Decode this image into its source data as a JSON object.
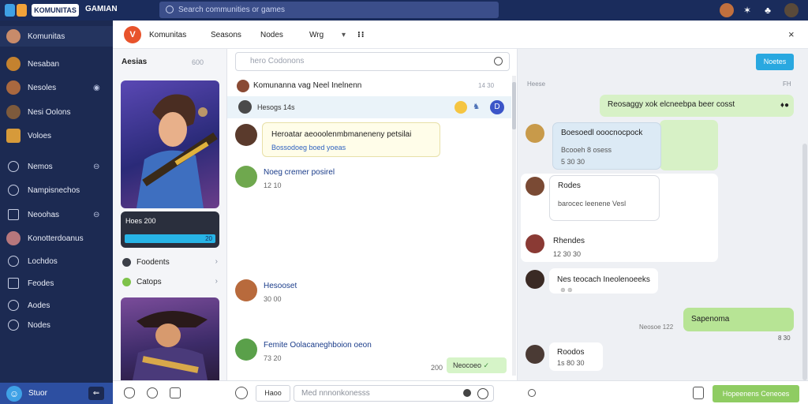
{
  "topbar": {
    "brand_pill": "KOMUNITAS",
    "brand": "GAMIAN",
    "search_placeholder": "Search communities or games",
    "colors": {
      "bg": "#1a2c5c",
      "search": "#3b4e8a"
    }
  },
  "sidebar": {
    "items": [
      {
        "label": "Komunitas"
      },
      {
        "label": "Nesaban"
      },
      {
        "label": "Nesoles"
      },
      {
        "label": "Nesi Oolons"
      },
      {
        "label": "Voloes"
      },
      {
        "label": "Nemos"
      },
      {
        "label": "Nampisnechos"
      },
      {
        "label": "Neoohas"
      },
      {
        "label": "Konotterdoanus"
      },
      {
        "label": "Lochdos"
      },
      {
        "label": "Feodes"
      },
      {
        "label": "Aodes"
      },
      {
        "label": "Nodes"
      }
    ],
    "footer": {
      "label": "Stuor",
      "button": "⇐"
    }
  },
  "header": {
    "tabs": [
      "Komunitas",
      "Seasons",
      "Nodes",
      "Wrg"
    ],
    "close": "×"
  },
  "games": {
    "title": "Aesias",
    "title_right": "600",
    "card1_footer": "Hoes 200",
    "card1_bar_value": "20",
    "rows": [
      {
        "label": "Foodents"
      },
      {
        "label": "Catops"
      }
    ]
  },
  "chat_list": {
    "search_placeholder": "hero Codonons",
    "thread_title": "Komunanna vag Neel Inelnenn",
    "thread_meta": "14 30",
    "thread_sub": "Hesogs 14s",
    "bubble": {
      "title": "Heroatar aeooolenmbmaneneny petsilai",
      "link": "Bossodoeg boed yoeas"
    },
    "msgs": [
      {
        "name": "Noeg cremer posirel",
        "meta": "12 10"
      },
      {
        "name": "Hesooset",
        "meta": "30 00"
      },
      {
        "name": "Femite Oolacaneghboion oeon",
        "meta": "73 20",
        "time": "200"
      }
    ],
    "green_chip": "Neocoeo"
  },
  "chat_right": {
    "button": "Noetes",
    "label_left": "Heese",
    "label_right": "FH",
    "bubbles": [
      {
        "text": "Reosaggy xok elcneebpa beer cosst",
        "meta": ""
      },
      {
        "text": "Boesoedl ooocnocpock",
        "meta": "Bcooeh 8 osess",
        "meta2": "5 30 30"
      },
      {
        "text": "Rodes",
        "meta": "barocec leenene Vesl",
        "meta2": ""
      },
      {
        "text": "Rhendes",
        "meta": "12 30 30"
      },
      {
        "text": "Nes teocach Ineolenoeeks",
        "meta": ""
      },
      {
        "text": "Sapenoma",
        "meta": "Neosoe 122",
        "meta2": "8 30"
      },
      {
        "text": "Roodos",
        "meta": "1s 80 30"
      }
    ]
  },
  "composer": {
    "chip": "Haoo",
    "placeholder": "Med nnnonkonesss",
    "send": "Hopeenens Ceneoes"
  }
}
